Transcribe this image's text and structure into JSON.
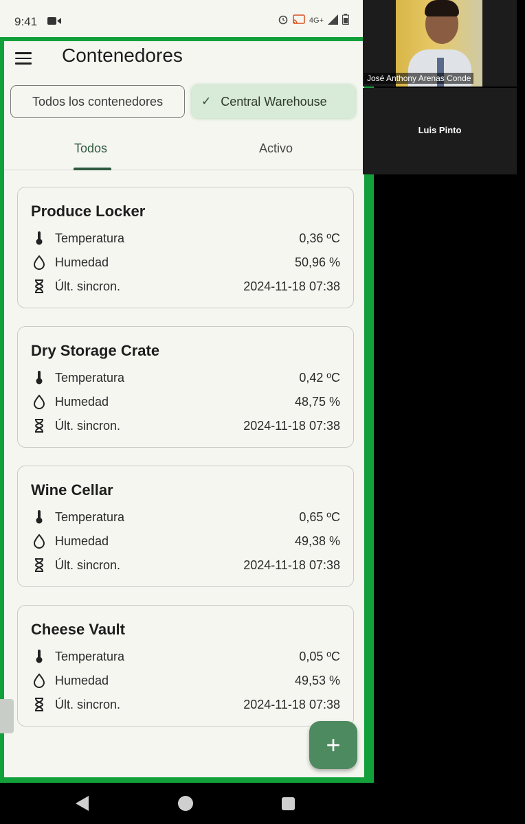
{
  "status": {
    "time": "9:41",
    "network": "4G+"
  },
  "app": {
    "title": "Contenedores",
    "filters": {
      "all": "Todos los contenedores",
      "warehouse": "Central Warehouse"
    },
    "tabs": {
      "todos": "Todos",
      "activo": "Activo"
    },
    "containers": [
      {
        "name": "Produce Locker",
        "temp_label": "Temperatura",
        "temp": "0,36 ºC",
        "hum_label": "Humedad",
        "hum": "50,96 %",
        "sync_label": "Últ. sincron.",
        "sync": "2024-11-18 07:38"
      },
      {
        "name": "Dry Storage Crate",
        "temp_label": "Temperatura",
        "temp": "0,42 ºC",
        "hum_label": "Humedad",
        "hum": "48,75 %",
        "sync_label": "Últ. sincron.",
        "sync": "2024-11-18 07:38"
      },
      {
        "name": "Wine Cellar",
        "temp_label": "Temperatura",
        "temp": "0,65 ºC",
        "hum_label": "Humedad",
        "hum": "49,38 %",
        "sync_label": "Últ. sincron.",
        "sync": "2024-11-18 07:38"
      },
      {
        "name": "Cheese Vault",
        "temp_label": "Temperatura",
        "temp": "0,05 ºC",
        "hum_label": "Humedad",
        "hum": "49,53 %",
        "sync_label": "Últ. sincron.",
        "sync": "2024-11-18 07:38"
      }
    ],
    "fab_label": "+"
  },
  "video": {
    "participant1": "José Anthony Arenas Conde",
    "participant2": "Luis Pinto"
  },
  "colors": {
    "frame": "#12a03a",
    "accent": "#2f5a3f",
    "fab": "#4e8a5f",
    "chip_selected": "#d8ead8"
  }
}
